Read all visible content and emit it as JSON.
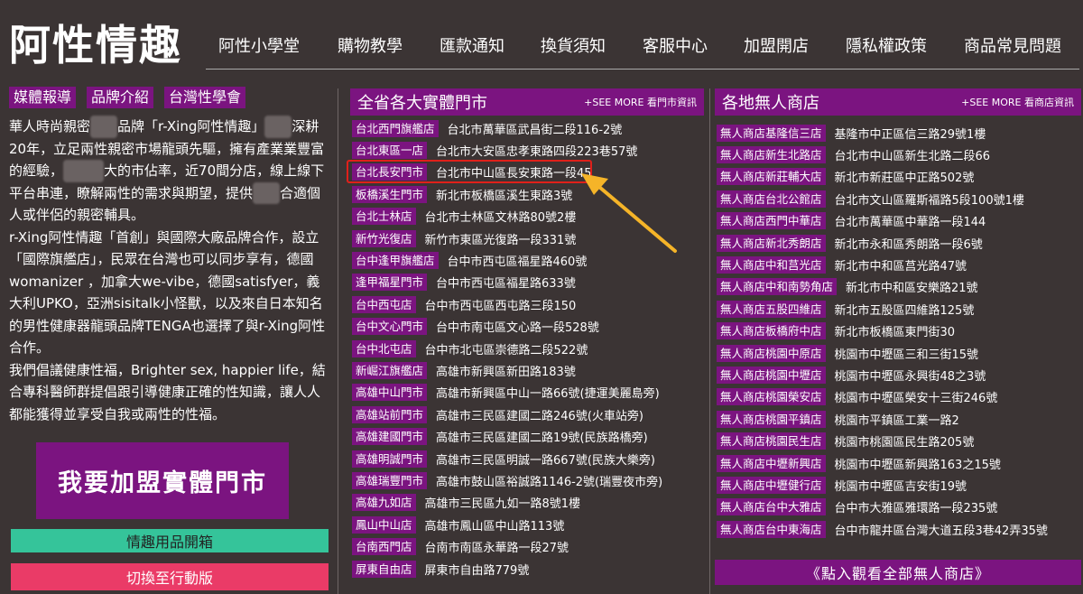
{
  "brand": {
    "logo": "阿性情趣"
  },
  "nav": [
    "阿性小學堂",
    "購物教學",
    "匯款通知",
    "換貨須知",
    "客服中心",
    "加盟開店",
    "隱私權政策",
    "商品常見問題"
  ],
  "tags": [
    "媒體報導",
    "品牌介紹",
    "台灣性學會"
  ],
  "intro": {
    "p1a": "華人時尚親密",
    "p1b": "品牌「r-Xing阿性情趣」",
    "p1c": "深耕20年，立足兩性親密市場龍頭先驅，擁有產業業豐富的經驗，",
    "p1d": "大的市佔率，近70間分店，線上線下平台串連，瞭解兩性的需求與期望，提供",
    "p1e": "合適個人或伴侶的親密輔具。",
    "p2": "r-Xing阿性情趣「首創」與國際大廠品牌合作，設立「國際旗艦店」，民眾在台灣也可以同步享有，德國womanizer ，加拿大we-vibe，德國satisfyer，義大利UPKO，亞洲sisitalk小怪獸，以及來自日本知名的男性健康器龍頭品牌TENGA也選擇了與r-Xing阿性合作。",
    "p3": "我們倡議健康性福，Brighter sex, happier life，結合專科醫師群提倡跟引導健康正確的性知識，讓人人都能獲得並享受自我或兩性的性福。"
  },
  "buttons": {
    "join": "我要加盟實體門市",
    "unbox": "情趣用品開箱",
    "mobile": "切換至行動版",
    "see_all_unmanned": "《點入觀看全部無人商店》"
  },
  "physical": {
    "title": "全省各大實體門市",
    "more": "+SEE MORE 看門市資訊",
    "stores": [
      {
        "name": "台北西門旗艦店",
        "addr": "台北市萬華區武昌街二段116-2號"
      },
      {
        "name": "台北東區一店",
        "addr": "台北市大安區忠孝東路四段223巷57號"
      },
      {
        "name": "台北長安門市",
        "addr": "台北市中山區長安東路一段45"
      },
      {
        "name": "板橋溪生門市",
        "addr": "新北市板橋區溪生東路3號"
      },
      {
        "name": "台北士林店",
        "addr": "台北市士林區文林路80號2樓"
      },
      {
        "name": "新竹光復店",
        "addr": "新竹市東區光復路一段331號"
      },
      {
        "name": "台中逢甲旗艦店",
        "addr": "台中市西屯區福星路460號"
      },
      {
        "name": "逢甲福星門市",
        "addr": "台中市西屯區福星路633號"
      },
      {
        "name": "台中西屯店",
        "addr": "台中市西屯區西屯路三段150"
      },
      {
        "name": "台中文心門市",
        "addr": "台中市南屯區文心路一段528號"
      },
      {
        "name": "台中北屯店",
        "addr": "台中市北屯區崇德路二段522號"
      },
      {
        "name": "新崛江旗艦店",
        "addr": "高雄市新興區新田路183號"
      },
      {
        "name": "高雄中山門市",
        "addr": "高雄市新興區中山一路66號(捷運美麗島旁)"
      },
      {
        "name": "高雄站前門市",
        "addr": "高雄市三民區建國二路246號(火車站旁)"
      },
      {
        "name": "高雄建國門市",
        "addr": "高雄市三民區建國二路19號(民族路橋旁)"
      },
      {
        "name": "高雄明誠門市",
        "addr": "高雄市三民區明誠一路667號(民族大樂旁)"
      },
      {
        "name": "高雄瑞豐門市",
        "addr": "高雄市鼓山區裕誠路1146-2號(瑞豐夜市旁)"
      },
      {
        "name": "高雄九如店",
        "addr": "高雄市三民區九如一路8號1樓"
      },
      {
        "name": "鳳山中山店",
        "addr": "高雄市鳳山區中山路113號"
      },
      {
        "name": "台南西門店",
        "addr": "台南市南區永華路一段27號"
      },
      {
        "name": "屏東自由店",
        "addr": "屏東市自由路779號"
      }
    ]
  },
  "unmanned": {
    "title": "各地無人商店",
    "more": "+SEE MORE 看商店資訊",
    "stores": [
      {
        "name": "無人商店基隆信三店",
        "addr": "基隆市中正區信三路29號1樓"
      },
      {
        "name": "無人商店新生北路店",
        "addr": "台北市中山區新生北路二段66"
      },
      {
        "name": "無人商店新莊輔大店",
        "addr": "新北市新莊區中正路502號"
      },
      {
        "name": "無人商店台北公館店",
        "addr": "台北市文山區羅斯福路5段100號1樓"
      },
      {
        "name": "無人商店西門中華店",
        "addr": "台北市萬華區中華路一段144"
      },
      {
        "name": "無人商店新北秀朗店",
        "addr": "新北市永和區秀朗路一段6號"
      },
      {
        "name": "無人商店中和莒光店",
        "addr": "新北市中和區莒光路47號"
      },
      {
        "name": "無人商店中和南勢角店",
        "addr": "新北市中和區安樂路21號"
      },
      {
        "name": "無人商店五股四維店",
        "addr": "新北市五股區四維路125號"
      },
      {
        "name": "無人商店板橋府中店",
        "addr": "新北市板橋區東門街30"
      },
      {
        "name": "無人商店桃園中原店",
        "addr": "桃園市中壢區三和三街15號"
      },
      {
        "name": "無人商店桃園中壢店",
        "addr": "桃園市中壢區永興街48之3號"
      },
      {
        "name": "無人商店桃園榮安店",
        "addr": "桃園市中壢區榮安十三街246號"
      },
      {
        "name": "無人商店桃園平鎮店",
        "addr": "桃園市平鎮區工業一路2"
      },
      {
        "name": "無人商店桃園民生店",
        "addr": "桃園市桃園區民生路205號"
      },
      {
        "name": "無人商店中壢新興店",
        "addr": "桃園市中壢區新興路163之15號"
      },
      {
        "name": "無人商店中壢健行店",
        "addr": "桃園市中壢區吉安街19號"
      },
      {
        "name": "無人商店台中大雅店",
        "addr": "台中市大雅區雅環路一段235號"
      },
      {
        "name": "無人商店台中東海店",
        "addr": "台中市龍井區台灣大道五段3巷42弄35號"
      }
    ]
  },
  "colors": {
    "background": "#3b3434",
    "purple": "#7b1480",
    "green": "#35c49a",
    "pink": "#ea3b67",
    "highlight": "#e0201a",
    "arrow": "#f5b428"
  }
}
